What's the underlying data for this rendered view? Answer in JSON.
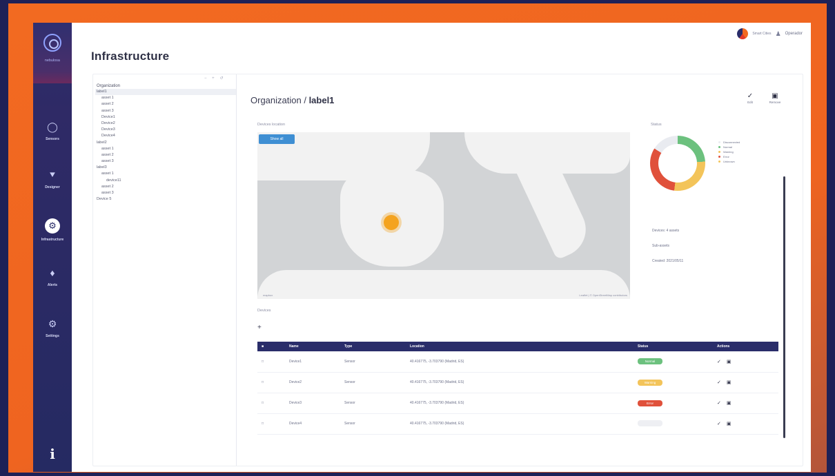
{
  "app": {
    "brand_name": "nebulosa",
    "user_name": "Operador",
    "brand_text": "Smart Cities"
  },
  "nav": [
    {
      "label": "Sensors",
      "icon": "dashboard-icon"
    },
    {
      "label": "Designer",
      "icon": "flow-icon"
    },
    {
      "label": "Infrastructure",
      "icon": "infrastructure-icon"
    },
    {
      "label": "Alerts",
      "icon": "bell-icon"
    },
    {
      "label": "Settings",
      "icon": "gear-icon"
    }
  ],
  "page": {
    "title": "Infrastructure"
  },
  "tree": {
    "root_label": "Organization",
    "items": [
      {
        "label": "label1",
        "depth": 0,
        "selected": true
      },
      {
        "label": "asset 1",
        "depth": 1
      },
      {
        "label": "asset 2",
        "depth": 1
      },
      {
        "label": "asset 3",
        "depth": 1
      },
      {
        "label": "Device1",
        "depth": 1
      },
      {
        "label": "Device2",
        "depth": 1
      },
      {
        "label": "Device3",
        "depth": 1
      },
      {
        "label": "Device4",
        "depth": 1
      },
      {
        "label": "label2",
        "depth": 0
      },
      {
        "label": "asset 1",
        "depth": 1
      },
      {
        "label": "asset 2",
        "depth": 1
      },
      {
        "label": "asset 3",
        "depth": 1
      },
      {
        "label": "label3",
        "depth": 0
      },
      {
        "label": "asset 1",
        "depth": 1
      },
      {
        "label": "device11",
        "depth": 2
      },
      {
        "label": "asset 2",
        "depth": 1
      },
      {
        "label": "asset 3",
        "depth": 1
      },
      {
        "label": "Device 5",
        "depth": 0
      }
    ]
  },
  "detail": {
    "title_prefix": "Organization /",
    "title_node": "label1",
    "actions": [
      {
        "label": "Edit",
        "icon": "edit-icon"
      },
      {
        "label": "Remove",
        "icon": "trash-icon"
      }
    ],
    "map_label": "Devices location",
    "map_badge": "Show all",
    "map_attr": "Leaflet | © OpenStreetMap contributors",
    "map_logo": "mapbox",
    "status_label": "Status",
    "legend": [
      {
        "label": "Disconnected",
        "color": "#e9ebf0"
      },
      {
        "label": "Normal",
        "color": "#6cc17e"
      },
      {
        "label": "Warning",
        "color": "#f3c45a"
      },
      {
        "label": "Error",
        "color": "#e0513b"
      },
      {
        "label": "Unknown",
        "color": "#f3c45a"
      }
    ],
    "kv": [
      "Devices: 4 assets",
      "Sub-assets",
      "Created: 2021/05/11"
    ],
    "devices_label": "Devices",
    "add_label": "+"
  },
  "table": {
    "headers": [
      "",
      "Name",
      "Type",
      "Location",
      "Status",
      "Actions"
    ],
    "rows": [
      {
        "name": "Device1",
        "type": "Sensor",
        "location": "40.416775, -3.703790 (Madrid, ES)",
        "status": "Normal",
        "status_color": "#6cc17e"
      },
      {
        "name": "Device2",
        "type": "Sensor",
        "location": "40.416775, -3.703790 (Madrid, ES)",
        "status": "Warning",
        "status_color": "#f3c45a"
      },
      {
        "name": "Device3",
        "type": "Sensor",
        "location": "40.416775, -3.703790 (Madrid, ES)",
        "status": "Error",
        "status_color": "#e0513b"
      },
      {
        "name": "Device4",
        "type": "Sensor",
        "location": "40.416775, -3.703790 (Madrid, ES)",
        "status": "",
        "status_color": "#eeeff3"
      }
    ]
  }
}
